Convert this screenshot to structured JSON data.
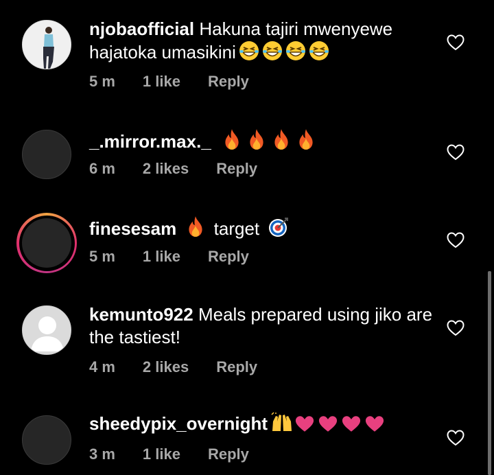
{
  "comments": [
    {
      "username": "njobaofficial",
      "text": "Hakuna tajiri mwenyewe hajatoka umasikini",
      "time": "5 m",
      "likes": "1 like",
      "reply": "Reply",
      "emoji": "grinning-squint-face x4"
    },
    {
      "username": "_.mirror.max._",
      "text": "",
      "time": "6 m",
      "likes": "2 likes",
      "reply": "Reply",
      "emoji": "fire x4"
    },
    {
      "username": "finesesam",
      "text": "target",
      "time": "5 m",
      "likes": "1 like",
      "reply": "Reply",
      "emoji": "fire, direct-hit"
    },
    {
      "username": "kemunto922",
      "text": "Meals prepared using jiko are the tastiest!",
      "time": "4 m",
      "likes": "2 likes",
      "reply": "Reply",
      "emoji": ""
    },
    {
      "username": "sheedypix_overnight",
      "text": "",
      "time": "3 m",
      "likes": "1 like",
      "reply": "Reply",
      "emoji": "raising-hands, heart x4"
    }
  ],
  "colors": {
    "background": "#000000",
    "meta": "#a8a8a8",
    "heart_emoji": "#e8407f",
    "fire": "#f15a24"
  }
}
